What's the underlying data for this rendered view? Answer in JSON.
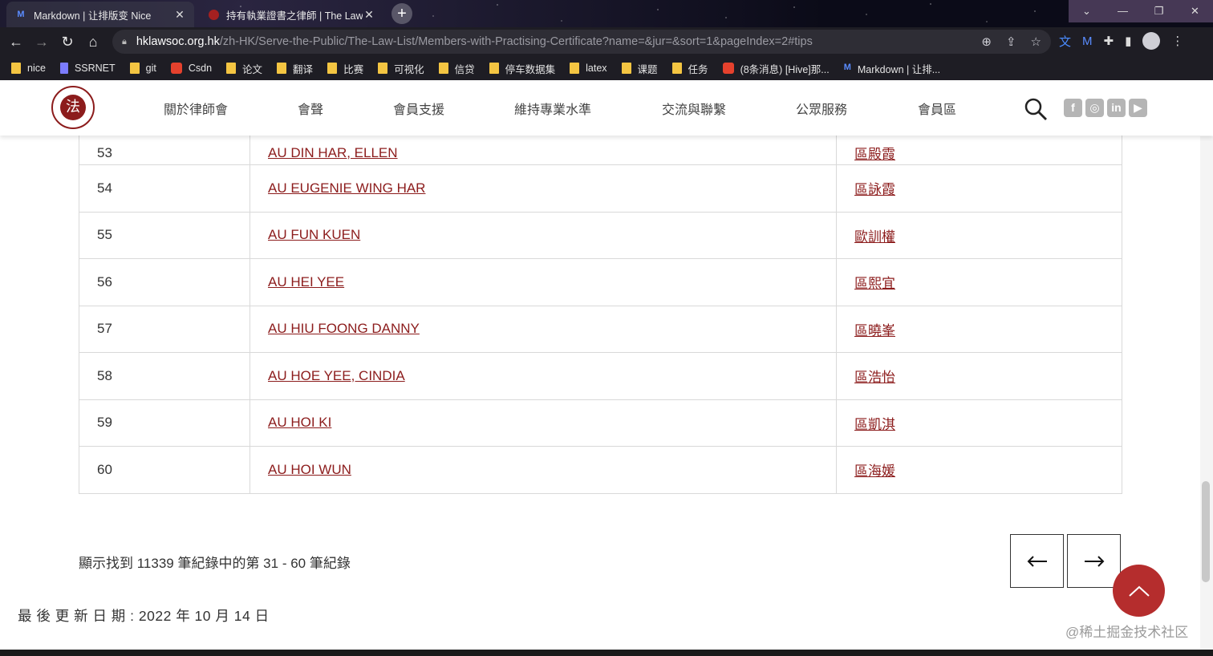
{
  "browser": {
    "tabs": [
      {
        "label": "Markdown | 让排版变 Nice",
        "icon": "M"
      },
      {
        "label": "持有執業證書之律師 | The Law",
        "icon": ""
      }
    ],
    "url_host": "hklawsoc.org.hk",
    "url_path": "/zh-HK/Serve-the-Public/The-Law-List/Members-with-Practising-Certificate?name=&jur=&sort=1&pageIndex=2#tips",
    "bookmarks": [
      {
        "label": "nice",
        "icon": "folder"
      },
      {
        "label": "SSRNET",
        "icon": "ssrn"
      },
      {
        "label": "git",
        "icon": "folder"
      },
      {
        "label": "Csdn",
        "icon": "csdn"
      },
      {
        "label": "论文",
        "icon": "folder"
      },
      {
        "label": "翻译",
        "icon": "folder"
      },
      {
        "label": "比赛",
        "icon": "folder"
      },
      {
        "label": "可视化",
        "icon": "folder"
      },
      {
        "label": "信贷",
        "icon": "folder"
      },
      {
        "label": "停车数据集",
        "icon": "folder"
      },
      {
        "label": "latex",
        "icon": "folder"
      },
      {
        "label": "课题",
        "icon": "folder"
      },
      {
        "label": "任务",
        "icon": "folder"
      },
      {
        "label": "(8条消息) [Hive]那...",
        "icon": "csdn"
      },
      {
        "label": "Markdown | 让排...",
        "icon": "md"
      }
    ]
  },
  "site": {
    "logo_char": "法",
    "nav": [
      "關於律師會",
      "會聲",
      "會員支援",
      "維持專業水準",
      "交流與聯繫",
      "公眾服務",
      "會員區"
    ],
    "social": [
      "f",
      "◎",
      "in",
      "▶"
    ]
  },
  "table": {
    "rows": [
      {
        "no": "53",
        "en": "AU DIN HAR, ELLEN",
        "zh": "區殿霞"
      },
      {
        "no": "54",
        "en": "AU EUGENIE WING HAR",
        "zh": "區詠霞"
      },
      {
        "no": "55",
        "en": "AU FUN KUEN",
        "zh": "歐訓權"
      },
      {
        "no": "56",
        "en": "AU HEI YEE",
        "zh": "區熙宜"
      },
      {
        "no": "57",
        "en": "AU HIU FOONG DANNY",
        "zh": "區曉峯"
      },
      {
        "no": "58",
        "en": "AU HOE YEE, CINDIA",
        "zh": "區浩怡"
      },
      {
        "no": "59",
        "en": "AU HOI KI",
        "zh": "區凱淇"
      },
      {
        "no": "60",
        "en": "AU HOI WUN",
        "zh": "區海媛"
      }
    ]
  },
  "summary": "顯示找到 11339 筆紀錄中的第 31 - 60 筆紀錄",
  "last_updated": "最 後 更 新 日 期 : 2022 年 10 月 14 日",
  "watermark": "@稀土掘金技术社区",
  "colors": {
    "accent": "#8c1c1c",
    "totop": "#b52d2d"
  }
}
